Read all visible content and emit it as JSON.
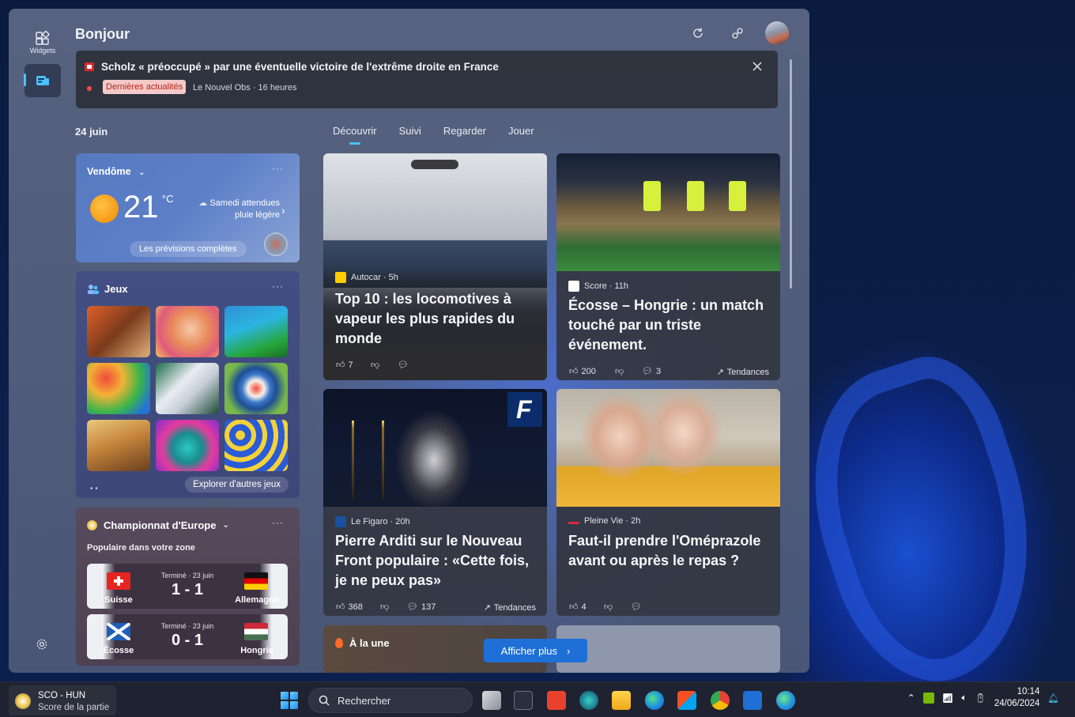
{
  "rail": {
    "widgets_label": "Widgets"
  },
  "header": {
    "greeting": "Bonjour"
  },
  "banner": {
    "headline": "Scholz « préoccupé » par une éventuelle victoire de l'extrême droite en France",
    "badge": "Dernières actualités",
    "source": "Le Nouvel Obs · 16 heures"
  },
  "date": "24 juin",
  "tabs": [
    {
      "label": "Découvrir",
      "active": true
    },
    {
      "label": "Suivi"
    },
    {
      "label": "Regarder"
    },
    {
      "label": "Jouer"
    }
  ],
  "weather": {
    "location": "Vendôme",
    "temp": "21",
    "unit": "°C",
    "forecast": "Samedi attendues pluie légère",
    "full_forecast": "Les prévisions complètes",
    "menu": "···"
  },
  "games": {
    "title": "Jeux",
    "menu": "···",
    "explore": "Explorer d'autres jeux",
    "pager": "• •"
  },
  "euro": {
    "title": "Championnat d'Europe",
    "subtitle": "Populaire dans votre zone",
    "menu": "···",
    "matches": [
      {
        "status": "Terminé · 23 juin",
        "score": "1 - 1",
        "home": "Suisse",
        "away": "Allemagne"
      },
      {
        "status": "Terminé · 23 juin",
        "score": "0 - 1",
        "home": "Écosse",
        "away": "Hongrie"
      }
    ]
  },
  "news": [
    {
      "source": "Autocar · 5h",
      "headline": "Top 10 : les locomotives à vapeur les plus rapides du monde",
      "likes": "7",
      "comments": ""
    },
    {
      "source": "Score · 11h",
      "headline": "Écosse – Hongrie : un match touché par un triste événement.",
      "likes": "200",
      "comments": "3",
      "trend": "Tendances"
    },
    {
      "source": "Le Figaro · 20h",
      "headline": "Pierre Arditi sur le Nouveau Front populaire : «Cette fois, je ne peux pas»",
      "likes": "368",
      "comments": "137",
      "trend": "Tendances"
    },
    {
      "source": "Pleine Vie · 2h",
      "headline": "Faut-il prendre l'Oméprazole avant ou après le repas ?",
      "likes": "4",
      "comments": ""
    }
  ],
  "top_stories": "À la une",
  "show_more": "Afficher plus",
  "taskbar": {
    "score_title": "SCO - HUN",
    "score_sub": "Score de la partie",
    "search": "Rechercher",
    "time": "10:14",
    "date": "24/06/2024"
  },
  "colors": {
    "accent": "#4cc2ff",
    "button": "#1e6fd6",
    "badge_bg": "#f4c9c7",
    "badge_text": "#b3261e"
  }
}
